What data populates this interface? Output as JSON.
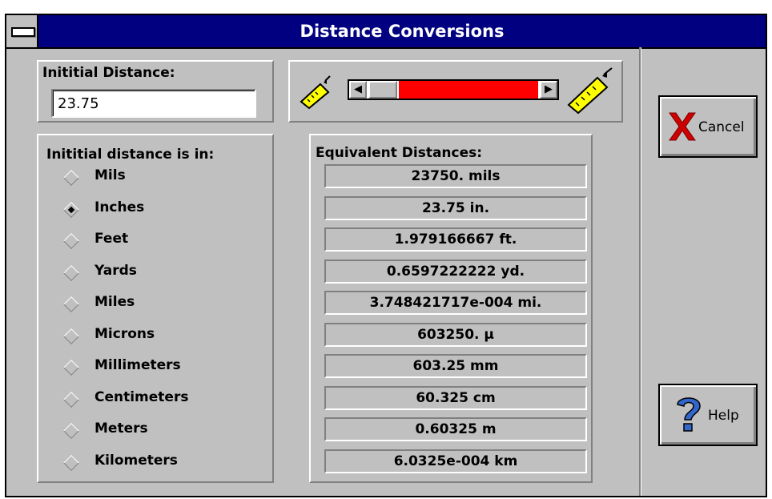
{
  "window": {
    "title": "Distance Conversions"
  },
  "initial": {
    "label": "Inititial Distance:",
    "value": "23.75"
  },
  "units": {
    "label": "Inititial distance is in:",
    "selected": "Inches",
    "items": [
      "Mils",
      "Inches",
      "Feet",
      "Yards",
      "Miles",
      "Microns",
      "Millimeters",
      "Centimeters",
      "Meters",
      "Kilometers"
    ]
  },
  "slider": {
    "position": 0.0,
    "fill_color": "#ff0000",
    "left_icon": "small-ruler-icon",
    "right_icon": "large-ruler-icon"
  },
  "results": {
    "label": "Equivalent Distances:",
    "values": [
      "23750. mils",
      "23.75 in.",
      "1.979166667 ft.",
      "0.6597222222 yd.",
      "3.748421717e-004 mi.",
      "603250. µ",
      "603.25 mm",
      "60.325 cm",
      "0.60325 m",
      "6.0325e-004 km"
    ]
  },
  "buttons": {
    "cancel": "Cancel",
    "help": "Help"
  },
  "colors": {
    "titlebar": "#000080",
    "face": "#c0c0c0",
    "cancel_x": "#cc0000",
    "help_q": "#3366cc"
  }
}
